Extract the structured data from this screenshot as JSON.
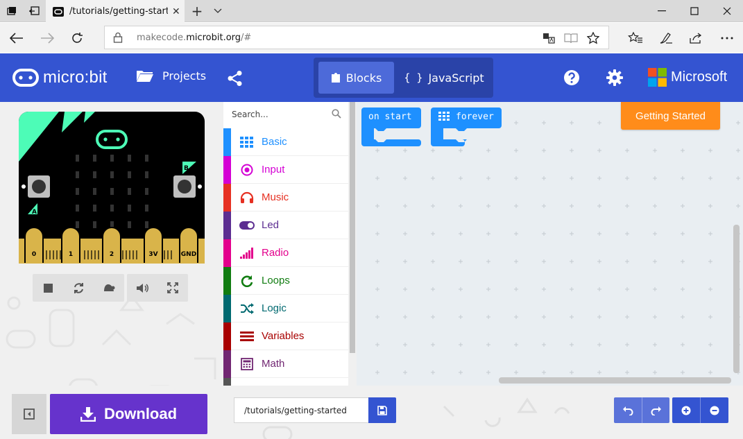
{
  "browser": {
    "tab_title": "/tutorials/getting-starte",
    "tab_close": "✕",
    "new_tab": "+",
    "address": {
      "host_prefix": "makecode.",
      "host_domain": "microbit.org",
      "path": "/#"
    }
  },
  "header": {
    "logo_text": "micro:bit",
    "projects_label": "Projects",
    "blocks_label": "Blocks",
    "javascript_label": "JavaScript",
    "brand_label": "Microsoft",
    "colors": {
      "header": "#3454d1",
      "toggle_bg": "#2a43a8",
      "toggle_active": "#4d6ad9"
    }
  },
  "simulator": {
    "pins": [
      "0",
      "1",
      "2",
      "3V",
      "GND"
    ],
    "button_a": "A",
    "button_b": "B"
  },
  "toolbox": {
    "search_placeholder": "Search...",
    "categories": [
      {
        "label": "Basic",
        "color": "#1e90ff",
        "icon": "grid-icon"
      },
      {
        "label": "Input",
        "color": "#d400d4",
        "icon": "target-icon"
      },
      {
        "label": "Music",
        "color": "#e63022",
        "icon": "headphones-icon"
      },
      {
        "label": "Led",
        "color": "#5c2d91",
        "icon": "toggle-icon"
      },
      {
        "label": "Radio",
        "color": "#e3008c",
        "icon": "signal-bars-icon"
      },
      {
        "label": "Loops",
        "color": "#107c10",
        "icon": "refresh-icon"
      },
      {
        "label": "Logic",
        "color": "#006970",
        "icon": "shuffle-icon"
      },
      {
        "label": "Variables",
        "color": "#a80000",
        "icon": "list-icon"
      },
      {
        "label": "Math",
        "color": "#712672",
        "icon": "calculator-icon"
      }
    ]
  },
  "workspace": {
    "blocks": [
      {
        "label": "on start",
        "color": "#1e90ff"
      },
      {
        "label": "forever",
        "color": "#1e90ff"
      }
    ],
    "getting_started_label": "Getting Started"
  },
  "bottom": {
    "download_label": "Download",
    "project_name": "/tutorials/getting-started"
  }
}
